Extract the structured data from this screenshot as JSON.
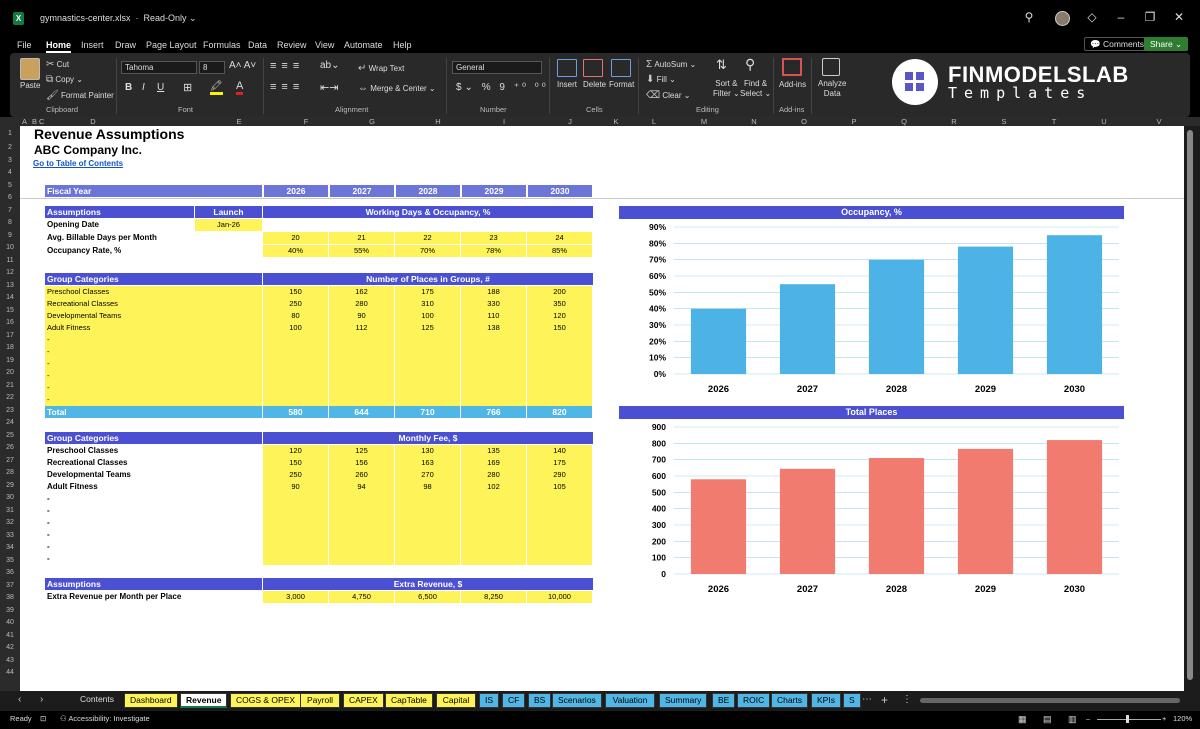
{
  "window": {
    "filename": "gymnastics-center.xlsx",
    "mode": "Read-Only ⌄"
  },
  "menu": [
    "File",
    "Home",
    "Insert",
    "Draw",
    "Page Layout",
    "Formulas",
    "Data",
    "Review",
    "View",
    "Automate",
    "Help"
  ],
  "top_buttons": {
    "comments": "Comments",
    "share": "Share ⌄"
  },
  "ribbon": {
    "clipboard": {
      "paste": "Paste",
      "cut": "Cut",
      "copy": "Copy",
      "format_painter": "Format Painter",
      "group": "Clipboard"
    },
    "font": {
      "name": "Tahoma",
      "size": "8",
      "group": "Font"
    },
    "alignment": {
      "wrap": "Wrap Text",
      "merge": "Merge & Center",
      "group": "Alignment"
    },
    "number": {
      "format": "General",
      "group": "Number"
    },
    "cells": {
      "insert": "Insert",
      "delete": "Delete",
      "format": "Format",
      "group": "Cells"
    },
    "editing": {
      "autosum": "AutoSum",
      "fill": "Fill",
      "clear": "Clear",
      "sort": "Sort &",
      "sort2": "Filter ⌄",
      "find": "Find &",
      "find2": "Select ⌄",
      "group": "Editing"
    },
    "addins": {
      "label": "Add-ins",
      "group": "Add-ins"
    },
    "analyze": {
      "label": "Analyze",
      "label2": "Data"
    },
    "brand": {
      "line1": "FINMODELSLAB",
      "line2": "Templates"
    }
  },
  "columns": [
    "A",
    "B",
    "C",
    "D",
    "E",
    "F",
    "G",
    "H",
    "I",
    "J",
    "K",
    "L",
    "M",
    "N",
    "O",
    "P",
    "Q",
    "R",
    "S",
    "T",
    "U",
    "V"
  ],
  "rows": [
    "1",
    "2",
    "3",
    "4",
    "5",
    "6",
    "7",
    "8",
    "9",
    "10",
    "11",
    "12",
    "13",
    "14",
    "15",
    "16",
    "17",
    "18",
    "19",
    "20",
    "21",
    "22",
    "23",
    "24",
    "25",
    "26",
    "27",
    "28",
    "29",
    "30",
    "31",
    "32",
    "33",
    "34",
    "35",
    "36",
    "37",
    "38",
    "39",
    "40",
    "41",
    "42",
    "43",
    "44"
  ],
  "sheet": {
    "title": "Revenue Assumptions",
    "company": "ABC Company Inc.",
    "toc_link": "Go to Table of Contents",
    "fiscal_year_label": "Fiscal Year",
    "years": [
      "2026",
      "2027",
      "2028",
      "2029",
      "2030"
    ],
    "assumptions": {
      "header": "Assumptions",
      "launch_header": "Launch",
      "section_header": "Working Days & Occupancy, %",
      "opening_date_label": "Opening Date",
      "opening_date": "Jan-26",
      "billable_label": "Avg. Billable Days per Month",
      "billable": [
        "20",
        "21",
        "22",
        "23",
        "24"
      ],
      "occupancy_label": "Occupancy Rate, %",
      "occupancy": [
        "40%",
        "55%",
        "70%",
        "78%",
        "85%"
      ]
    },
    "places": {
      "header": "Group Categories",
      "section_header": "Number of Places in Groups, #",
      "rows": [
        {
          "label": "Preschool Classes",
          "values": [
            "150",
            "162",
            "175",
            "188",
            "200"
          ]
        },
        {
          "label": "Recreational Classes",
          "values": [
            "250",
            "280",
            "310",
            "330",
            "350"
          ]
        },
        {
          "label": "Developmental Teams",
          "values": [
            "80",
            "90",
            "100",
            "110",
            "120"
          ]
        },
        {
          "label": "Adult Fitness",
          "values": [
            "100",
            "112",
            "125",
            "138",
            "150"
          ]
        },
        {
          "label": "-",
          "values": [
            "",
            "",
            "",
            "",
            ""
          ]
        },
        {
          "label": "-",
          "values": [
            "",
            "",
            "",
            "",
            ""
          ]
        },
        {
          "label": "-",
          "values": [
            "",
            "",
            "",
            "",
            ""
          ]
        },
        {
          "label": "-",
          "values": [
            "",
            "",
            "",
            "",
            ""
          ]
        },
        {
          "label": "-",
          "values": [
            "",
            "",
            "",
            "",
            ""
          ]
        },
        {
          "label": "-",
          "values": [
            "",
            "",
            "",
            "",
            ""
          ]
        }
      ],
      "total_label": "Total",
      "total": [
        "580",
        "644",
        "710",
        "766",
        "820"
      ]
    },
    "fees": {
      "header": "Group Categories",
      "section_header": "Monthly Fee, $",
      "rows": [
        {
          "label": "Preschool Classes",
          "values": [
            "120",
            "125",
            "130",
            "135",
            "140"
          ]
        },
        {
          "label": "Recreational Classes",
          "values": [
            "150",
            "156",
            "163",
            "169",
            "175"
          ]
        },
        {
          "label": "Developmental Teams",
          "values": [
            "250",
            "260",
            "270",
            "280",
            "290"
          ]
        },
        {
          "label": "Adult Fitness",
          "values": [
            "90",
            "94",
            "98",
            "102",
            "105"
          ]
        },
        {
          "label": "-",
          "values": [
            "",
            "",
            "",
            "",
            ""
          ]
        },
        {
          "label": "-",
          "values": [
            "",
            "",
            "",
            "",
            ""
          ]
        },
        {
          "label": "-",
          "values": [
            "",
            "",
            "",
            "",
            ""
          ]
        },
        {
          "label": "-",
          "values": [
            "",
            "",
            "",
            "",
            ""
          ]
        },
        {
          "label": "-",
          "values": [
            "",
            "",
            "",
            "",
            ""
          ]
        },
        {
          "label": "-",
          "values": [
            "",
            "",
            "",
            "",
            ""
          ]
        }
      ]
    },
    "extra": {
      "header": "Assumptions",
      "section_header": "Extra Revenue, $",
      "label": "Extra Revenue per Month per Place",
      "values": [
        "3,000",
        "4,750",
        "6,500",
        "8,250",
        "10,000"
      ]
    }
  },
  "chart_data": [
    {
      "type": "bar",
      "title": "Occupancy, %",
      "categories": [
        "2026",
        "2027",
        "2028",
        "2029",
        "2030"
      ],
      "values": [
        40,
        55,
        70,
        78,
        85
      ],
      "ylim": [
        0,
        90
      ],
      "yticks": [
        "0%",
        "10%",
        "20%",
        "30%",
        "40%",
        "50%",
        "60%",
        "70%",
        "80%",
        "90%"
      ],
      "color": "#4db3e6",
      "grid": true
    },
    {
      "type": "bar",
      "title": "Total Places",
      "categories": [
        "2026",
        "2027",
        "2028",
        "2029",
        "2030"
      ],
      "values": [
        580,
        644,
        710,
        766,
        820
      ],
      "ylim": [
        0,
        900
      ],
      "yticks": [
        "0",
        "100",
        "200",
        "300",
        "400",
        "500",
        "600",
        "700",
        "800",
        "900"
      ],
      "color": "#f07b6e",
      "grid": true
    }
  ],
  "tabs": [
    {
      "label": "Contents",
      "style": "plain"
    },
    {
      "label": "Dashboard",
      "style": "y"
    },
    {
      "label": "Revenue",
      "style": "active"
    },
    {
      "label": "COGS & OPEX",
      "style": "y"
    },
    {
      "label": "Payroll",
      "style": "y"
    },
    {
      "label": "CAPEX",
      "style": "y"
    },
    {
      "label": "CapTable",
      "style": "y"
    },
    {
      "label": "Capital",
      "style": "y"
    },
    {
      "label": "IS",
      "style": "b"
    },
    {
      "label": "CF",
      "style": "b"
    },
    {
      "label": "BS",
      "style": "b"
    },
    {
      "label": "Scenarios",
      "style": "b"
    },
    {
      "label": "Valuation",
      "style": "b"
    },
    {
      "label": "Summary",
      "style": "b"
    },
    {
      "label": "BE",
      "style": "b"
    },
    {
      "label": "ROIC",
      "style": "b"
    },
    {
      "label": "Charts",
      "style": "b"
    },
    {
      "label": "KPIs",
      "style": "b"
    },
    {
      "label": "S",
      "style": "b"
    }
  ],
  "status": {
    "ready": "Ready",
    "accessibility": "Accessibility: Investigate",
    "zoom": "120%"
  },
  "colors": {
    "header_blue": "#4b4fd1",
    "fiscal_blue": "#6c75d8",
    "input_yellow": "#fff35a",
    "total_cyan": "#4fb6e6",
    "excel_green": "#107c41"
  }
}
